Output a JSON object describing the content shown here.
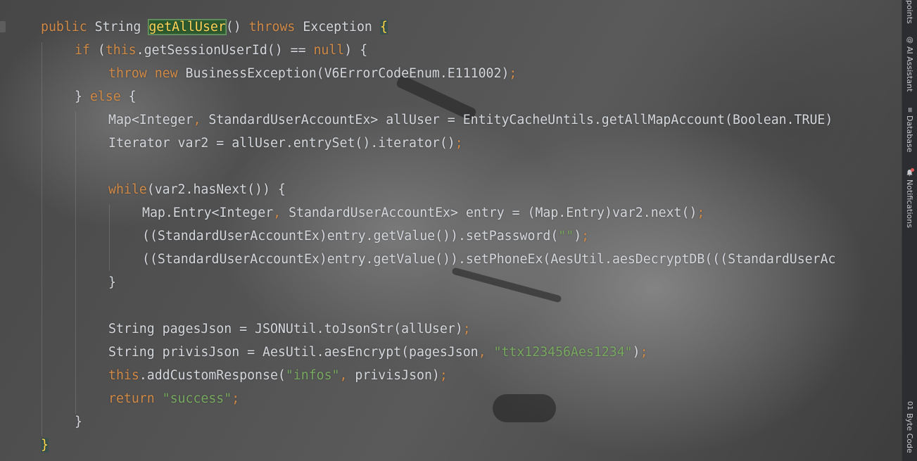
{
  "editor": {
    "lines": [
      {
        "indent": 0,
        "parts": [
          {
            "t": "public ",
            "c": "kw"
          },
          {
            "t": "String ",
            "c": "def"
          },
          {
            "t": "getAllUser",
            "c": "hl-decl"
          },
          {
            "t": "() ",
            "c": "def"
          },
          {
            "t": "throws ",
            "c": "kw"
          },
          {
            "t": "Exception ",
            "c": "def"
          },
          {
            "t": "{",
            "c": "brace-hl"
          }
        ]
      },
      {
        "indent": 1,
        "parts": [
          {
            "t": "if ",
            "c": "kw"
          },
          {
            "t": "(",
            "c": "def"
          },
          {
            "t": "this",
            "c": "kw"
          },
          {
            "t": ".getSessionUserId() == ",
            "c": "def"
          },
          {
            "t": "null",
            "c": "kw"
          },
          {
            "t": ") {",
            "c": "def"
          }
        ]
      },
      {
        "indent": 2,
        "parts": [
          {
            "t": "throw new ",
            "c": "kw"
          },
          {
            "t": "BusinessException(V6ErrorCodeEnum.E111002)",
            "c": "def"
          },
          {
            "t": ";",
            "c": "semi"
          }
        ]
      },
      {
        "indent": 1,
        "parts": [
          {
            "t": "} ",
            "c": "def"
          },
          {
            "t": "else ",
            "c": "kw"
          },
          {
            "t": "{",
            "c": "def"
          }
        ]
      },
      {
        "indent": 2,
        "parts": [
          {
            "t": "Map<Integer",
            "c": "def"
          },
          {
            "t": ", ",
            "c": "semi"
          },
          {
            "t": "StandardUserAccountEx> allUser = EntityCacheUntils.getAllMapAccount(Boolean.TRUE)",
            "c": "def"
          }
        ]
      },
      {
        "indent": 2,
        "parts": [
          {
            "t": "Iterator var2 = allUser.entrySet().iterator()",
            "c": "def"
          },
          {
            "t": ";",
            "c": "semi"
          }
        ]
      },
      {
        "indent": 2,
        "parts": []
      },
      {
        "indent": 2,
        "parts": [
          {
            "t": "while",
            "c": "kw"
          },
          {
            "t": "(var2.hasNext()) {",
            "c": "def"
          }
        ]
      },
      {
        "indent": 3,
        "parts": [
          {
            "t": "Map.Entry<Integer",
            "c": "def"
          },
          {
            "t": ", ",
            "c": "semi"
          },
          {
            "t": "StandardUserAccountEx> entry = (Map.Entry)var2.next()",
            "c": "def"
          },
          {
            "t": ";",
            "c": "semi"
          }
        ]
      },
      {
        "indent": 3,
        "parts": [
          {
            "t": "((StandardUserAccountEx)entry.getValue()).setPassword(",
            "c": "def"
          },
          {
            "t": "\"\"",
            "c": "str"
          },
          {
            "t": ")",
            "c": "def"
          },
          {
            "t": ";",
            "c": "semi"
          }
        ]
      },
      {
        "indent": 3,
        "parts": [
          {
            "t": "((StandardUserAccountEx)entry.getValue()).setPhoneEx(AesUtil.aesDecryptDB(((StandardUserAc",
            "c": "def"
          }
        ]
      },
      {
        "indent": 2,
        "parts": [
          {
            "t": "}",
            "c": "def"
          }
        ]
      },
      {
        "indent": 2,
        "parts": []
      },
      {
        "indent": 2,
        "parts": [
          {
            "t": "String pagesJson = JSONUtil.toJsonStr(allUser)",
            "c": "def"
          },
          {
            "t": ";",
            "c": "semi"
          }
        ]
      },
      {
        "indent": 2,
        "parts": [
          {
            "t": "String privisJson = AesUtil.aesEncrypt(pagesJson",
            "c": "def"
          },
          {
            "t": ", ",
            "c": "semi"
          },
          {
            "t": "\"ttx123456Aes1234\"",
            "c": "str"
          },
          {
            "t": ")",
            "c": "def"
          },
          {
            "t": ";",
            "c": "semi"
          }
        ]
      },
      {
        "indent": 2,
        "parts": [
          {
            "t": "this",
            "c": "kw"
          },
          {
            "t": ".addCustomResponse(",
            "c": "def"
          },
          {
            "t": "\"infos\"",
            "c": "str"
          },
          {
            "t": ", ",
            "c": "semi"
          },
          {
            "t": "privisJson)",
            "c": "def"
          },
          {
            "t": ";",
            "c": "semi"
          }
        ]
      },
      {
        "indent": 2,
        "parts": [
          {
            "t": "return ",
            "c": "kw"
          },
          {
            "t": "\"success\"",
            "c": "str"
          },
          {
            "t": ";",
            "c": "semi"
          }
        ]
      },
      {
        "indent": 1,
        "parts": [
          {
            "t": "}",
            "c": "def"
          }
        ]
      },
      {
        "indent": 0,
        "parts": [
          {
            "t": "}",
            "c": "brace-hl"
          }
        ]
      }
    ]
  },
  "sidebar": {
    "items": [
      {
        "label": "points",
        "icon": ""
      },
      {
        "label": "AI Assistant",
        "icon": "@"
      },
      {
        "label": "Database",
        "icon": "≡"
      },
      {
        "label": "Notifications",
        "icon": "bell"
      },
      {
        "label": "Byte Code",
        "icon": "01"
      }
    ]
  }
}
